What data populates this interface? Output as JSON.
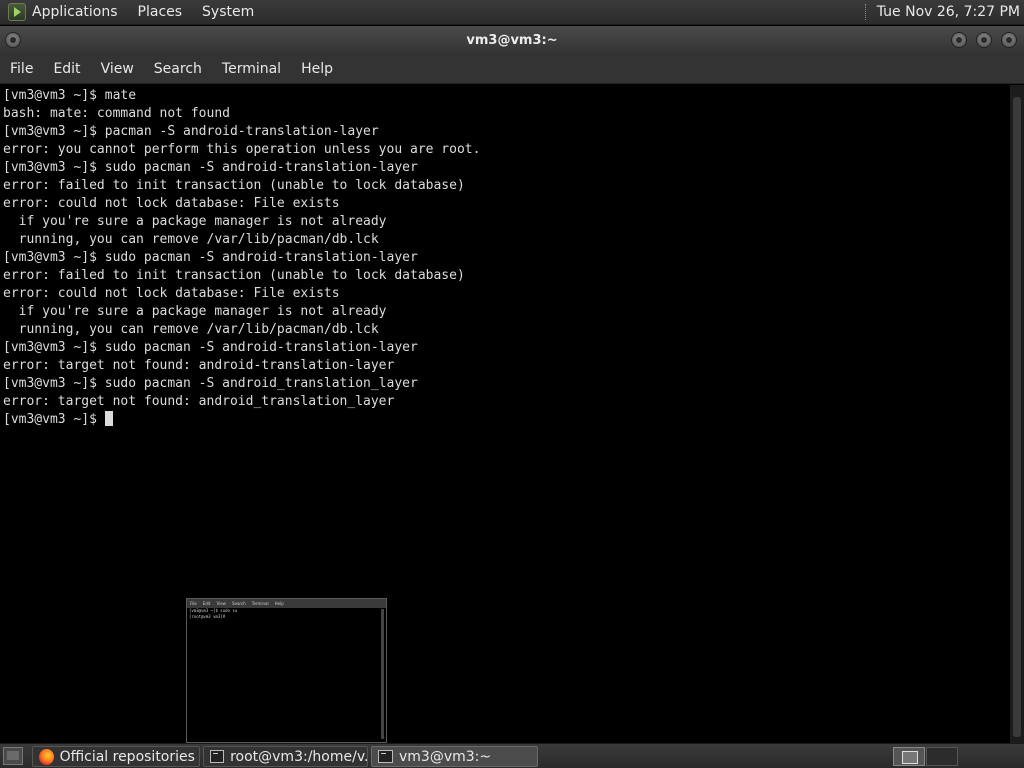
{
  "top_panel": {
    "menus": [
      "Applications",
      "Places",
      "System"
    ],
    "clock": "Tue Nov 26,  7:27 PM"
  },
  "window": {
    "title": "vm3@vm3:~"
  },
  "menubar": [
    "File",
    "Edit",
    "View",
    "Search",
    "Terminal",
    "Help"
  ],
  "terminal": {
    "lines": [
      "[vm3@vm3 ~]$ mate",
      "bash: mate: command not found",
      "[vm3@vm3 ~]$ pacman -S android-translation-layer",
      "error: you cannot perform this operation unless you are root.",
      "[vm3@vm3 ~]$ sudo pacman -S android-translation-layer",
      "error: failed to init transaction (unable to lock database)",
      "error: could not lock database: File exists",
      "  if you're sure a package manager is not already",
      "  running, you can remove /var/lib/pacman/db.lck",
      "[vm3@vm3 ~]$ sudo pacman -S android-translation-layer",
      "error: failed to init transaction (unable to lock database)",
      "error: could not lock database: File exists",
      "  if you're sure a package manager is not already",
      "  running, you can remove /var/lib/pacman/db.lck",
      "[vm3@vm3 ~]$ sudo pacman -S android-translation-layer",
      "error: target not found: android-translation-layer",
      "[vm3@vm3 ~]$ sudo pacman -S android_translation_layer",
      "error: target not found: android_translation_layer"
    ],
    "prompt": "[vm3@vm3 ~]$ "
  },
  "thumbnail": {
    "menus": [
      "File",
      "Edit",
      "View",
      "Search",
      "Terminal",
      "Help"
    ],
    "lines": [
      "[vm3@vm3 ~]$ sudo su",
      "[root@vm3 vm3]# "
    ]
  },
  "taskbar": {
    "tasks": [
      {
        "label": "Official repositories ...",
        "icon": "firefox-icon"
      },
      {
        "label": "root@vm3:/home/v...",
        "icon": "terminal-icon"
      },
      {
        "label": "vm3@vm3:~",
        "icon": "terminal-icon"
      }
    ]
  },
  "colors": {
    "terminal_bg": "#000000",
    "terminal_fg": "#dcdcdc",
    "panel_bg": "#333333"
  }
}
